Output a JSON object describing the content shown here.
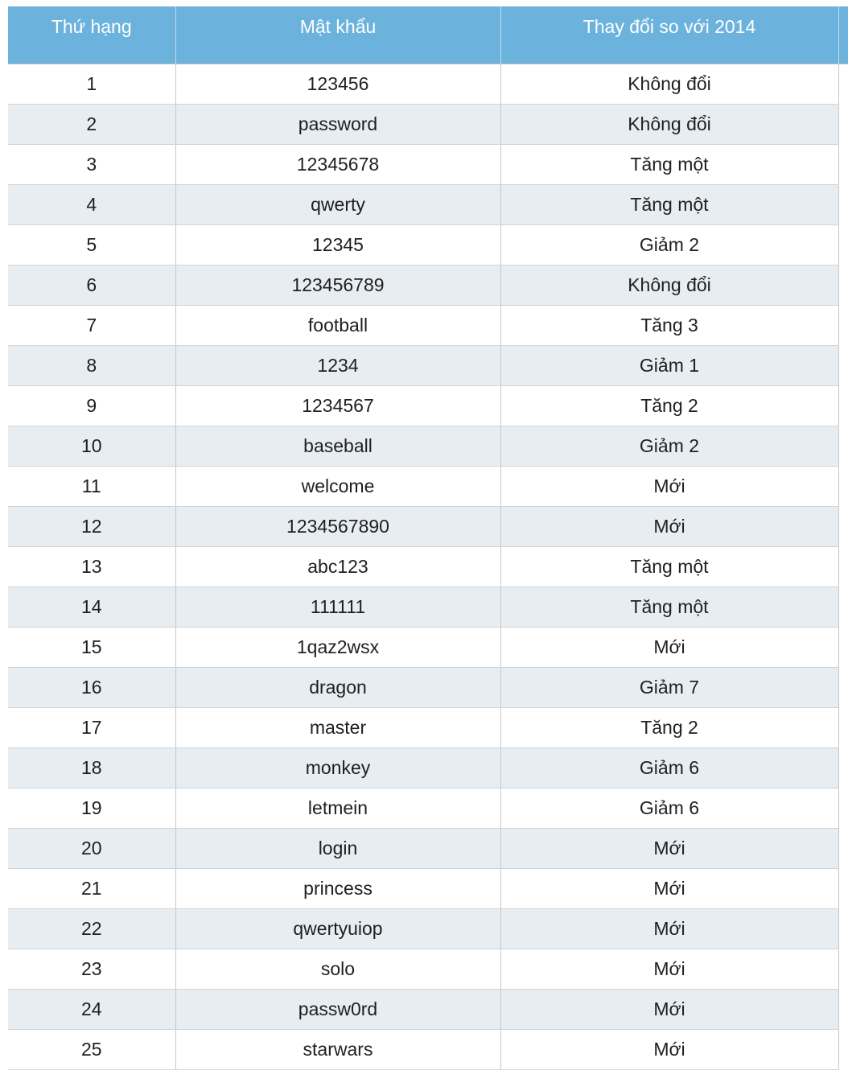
{
  "table": {
    "headers": {
      "rank": "Thứ hạng",
      "password": "Mật khẩu",
      "change": "Thay đổi so với 2014"
    },
    "rows": [
      {
        "rank": "1",
        "password": "123456",
        "change": "Không đổi"
      },
      {
        "rank": "2",
        "password": "password",
        "change": "Không đổi"
      },
      {
        "rank": "3",
        "password": "12345678",
        "change": "Tăng một"
      },
      {
        "rank": "4",
        "password": "qwerty",
        "change": "Tăng một"
      },
      {
        "rank": "5",
        "password": "12345",
        "change": "Giảm 2"
      },
      {
        "rank": "6",
        "password": "123456789",
        "change": "Không đổi"
      },
      {
        "rank": "7",
        "password": "football",
        "change": "Tăng 3"
      },
      {
        "rank": "8",
        "password": "1234",
        "change": "Giảm 1"
      },
      {
        "rank": "9",
        "password": "1234567",
        "change": "Tăng 2"
      },
      {
        "rank": "10",
        "password": "baseball",
        "change": "Giảm 2"
      },
      {
        "rank": "11",
        "password": "welcome",
        "change": "Mới"
      },
      {
        "rank": "12",
        "password": "1234567890",
        "change": "Mới"
      },
      {
        "rank": "13",
        "password": "abc123",
        "change": "Tăng một"
      },
      {
        "rank": "14",
        "password": "111111",
        "change": "Tăng một"
      },
      {
        "rank": "15",
        "password": "1qaz2wsx",
        "change": "Mới"
      },
      {
        "rank": "16",
        "password": "dragon",
        "change": "Giảm 7"
      },
      {
        "rank": "17",
        "password": "master",
        "change": "Tăng 2"
      },
      {
        "rank": "18",
        "password": "monkey",
        "change": "Giảm 6"
      },
      {
        "rank": "19",
        "password": "letmein",
        "change": "Giảm 6"
      },
      {
        "rank": "20",
        "password": "login",
        "change": "Mới"
      },
      {
        "rank": "21",
        "password": "princess",
        "change": "Mới"
      },
      {
        "rank": "22",
        "password": "qwertyuiop",
        "change": "Mới"
      },
      {
        "rank": "23",
        "password": "solo",
        "change": "Mới"
      },
      {
        "rank": "24",
        "password": "passw0rd",
        "change": "Mới"
      },
      {
        "rank": "25",
        "password": "starwars",
        "change": "Mới"
      }
    ]
  },
  "colors": {
    "header_bg": "#6bb3dd",
    "header_text": "#ffffff",
    "row_alt_bg": "#e8edf1",
    "row_bg": "#ffffff"
  }
}
